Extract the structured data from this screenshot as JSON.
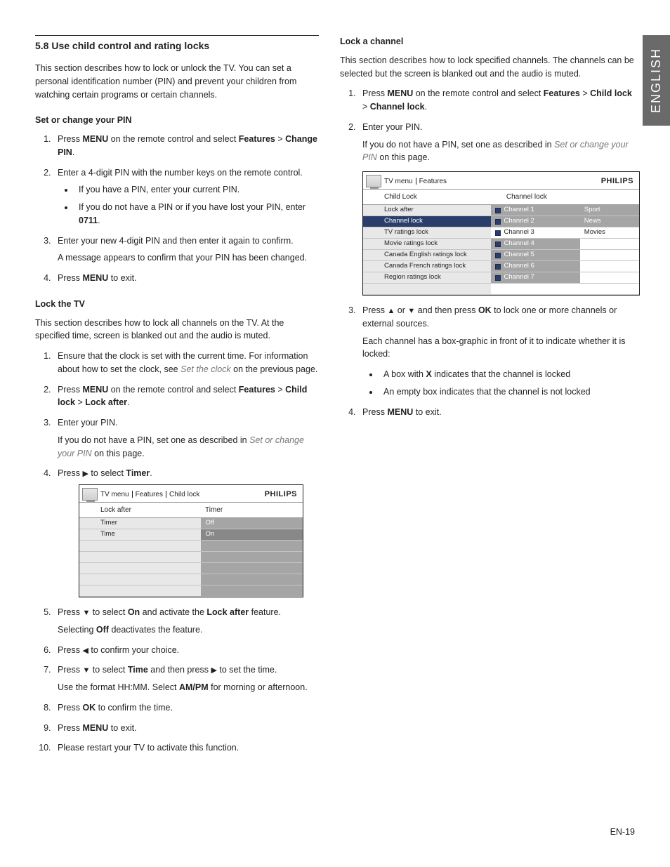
{
  "language_tab": "ENGLISH",
  "page_number": "EN-19",
  "heading": "5.8    Use child control and rating locks",
  "intro": "This section describes how to lock or unlock the TV.  You can set a personal identification number (PIN) and prevent your children from watching certain programs or certain channels.",
  "pin": {
    "title": "Set or change your PIN",
    "s1a": "Press ",
    "s1b": "MENU",
    "s1c": " on the remote control and select ",
    "s1d": "Features",
    "s1e": " > ",
    "s1f": "Change PIN",
    "s1g": ".",
    "s2": "Enter a 4-digit PIN with the number keys on the remote control.",
    "s2_b1": "If you have a PIN, enter your current PIN.",
    "s2_b2a": "If you do not have a PIN or if you have lost your PIN, enter ",
    "s2_b2b": "0711",
    "s2_b2c": ".",
    "s3a": "Enter your new 4-digit PIN and then enter it again to confirm.",
    "s3b": "A message appears to confirm that your PIN has been changed.",
    "s4a": "Press ",
    "s4b": "MENU",
    "s4c": " to exit."
  },
  "locktv": {
    "title": "Lock the TV",
    "intro": "This section describes how to lock all channels on the TV.  At the specified time, screen is blanked out and the audio is muted.",
    "s1a": "Ensure that the clock is set with the current time.  For information about how to set the clock, see ",
    "s1b": "Set the clock",
    "s1c": " on the previous page.",
    "s2a": "Press ",
    "s2b": "MENU",
    "s2c": " on the remote control and select ",
    "s2d": "Features",
    "s2e": " > ",
    "s2f": "Child lock",
    "s2g": " > ",
    "s2h": "Lock after",
    "s2i": ".",
    "s3": "Enter your PIN.",
    "s3_suba": "If you do not have a PIN, set one as described in ",
    "s3_subb": "Set or change your PIN",
    "s3_subc": " on this page.",
    "s4a": "Press ",
    "s4b": " to select ",
    "s4c": "Timer",
    "s4d": ".",
    "s5a": "Press ",
    "s5b": " to select ",
    "s5c": "On",
    "s5d": " and activate the ",
    "s5e": "Lock after",
    "s5f": " feature.",
    "s5g": "Selecting ",
    "s5h": "Off",
    "s5i": " deactivates the feature.",
    "s6a": "Press ",
    "s6b": " to confirm your choice.",
    "s7a": "Press ",
    "s7b": " to select ",
    "s7c": "Time",
    "s7d": " and then press ",
    "s7e": " to set the time.",
    "s7f": "Use the format HH:MM.  Select ",
    "s7g": "AM/PM",
    "s7h": " for morning or afternoon.",
    "s8a": "Press ",
    "s8b": "OK",
    "s8c": " to confirm the time.",
    "s9a": "Press ",
    "s9b": "MENU",
    "s9c": " to exit.",
    "s10": "Please restart your TV to activate this function."
  },
  "menu1": {
    "crumb1": "TV menu",
    "crumb2": "Features",
    "crumb3": "Child lock",
    "brand": "PHILIPS",
    "sub_left": "Lock after",
    "sub_right": "Timer",
    "left_rows": [
      "Timer",
      "Time"
    ],
    "right_rows": [
      "Off",
      "On"
    ]
  },
  "lockch": {
    "title": "Lock a channel",
    "intro": "This section describes how to lock specified channels.  The channels can be selected but the screen is blanked out and the audio is muted.",
    "s1a": "Press ",
    "s1b": "MENU",
    "s1c": " on the remote control and select ",
    "s1d": "Features",
    "s1e": " > ",
    "s1f": "Child lock",
    "s1g": " > ",
    "s1h": "Channel lock",
    "s1i": ".",
    "s2": "Enter your PIN.",
    "s2_suba": "If you do not have a PIN, set one as described in ",
    "s2_subb": "Set or change your PIN",
    "s2_subc": " on this page.",
    "s3a": "Press ",
    "s3b": " or ",
    "s3c": " and then press ",
    "s3d": "OK",
    "s3e": " to lock one or more channels or external sources.",
    "s3_sub": "Each channel has a box-graphic in front of it to indicate whether it is locked:",
    "s3_b1a": "A box with ",
    "s3_b1b": "X",
    "s3_b1c": " indicates that the channel is locked",
    "s3_b2": "An empty box indicates that the channel is not locked",
    "s4a": "Press ",
    "s4b": "MENU",
    "s4c": " to exit."
  },
  "menu2": {
    "crumb1": "TV menu",
    "crumb2": "Features",
    "brand": "PHILIPS",
    "sub_left": "Child Lock",
    "sub_right": "Channel lock",
    "left_rows": [
      "Lock after",
      "Channel lock",
      "TV ratings lock",
      "Movie ratings lock",
      "Canada English ratings lock",
      "Canada French ratings lock",
      "Region ratings lock"
    ],
    "mid_rows": [
      "Channel 1",
      "Channel 2",
      "Channel 3",
      "Channel 4",
      "Channel 5",
      "Channel 6",
      "Channel 7"
    ],
    "right_rows": [
      "Sport",
      "News",
      "Movies",
      "",
      "",
      "",
      ""
    ]
  },
  "glyph": {
    "up": "▲",
    "down": "▼",
    "left": "◀",
    "right": "▶"
  }
}
